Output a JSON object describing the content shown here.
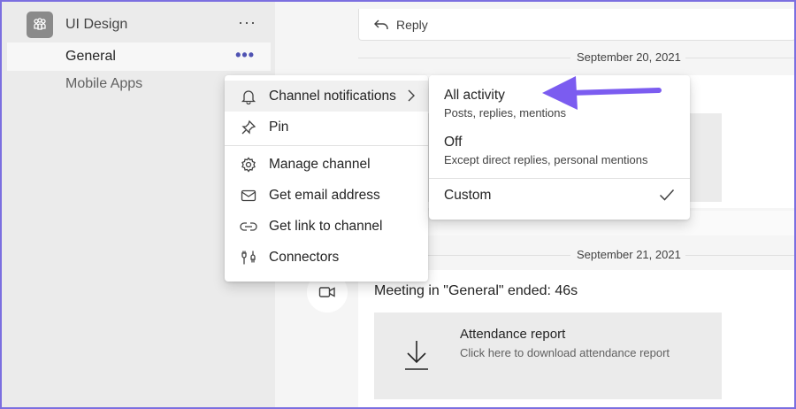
{
  "sidebar": {
    "team": {
      "name": "UI Design",
      "more_label": "···"
    },
    "channels": [
      {
        "label": "General",
        "more_label": "•••"
      },
      {
        "label": "Mobile Apps"
      }
    ]
  },
  "feed": {
    "reply_label": "Reply",
    "dates": [
      "September 20, 2021",
      "September 21, 2021"
    ],
    "meeting_text": "Meeting in \"General\" ended: 46s",
    "attendance": {
      "title": "Attendance report",
      "subtitle": "Click here to download attendance report"
    }
  },
  "context_menu": {
    "items": [
      {
        "label": "Channel notifications",
        "icon": "bell-icon"
      },
      {
        "label": "Pin",
        "icon": "pin-icon"
      },
      {
        "label": "Manage channel",
        "icon": "gear-icon"
      },
      {
        "label": "Get email address",
        "icon": "mail-icon"
      },
      {
        "label": "Get link to channel",
        "icon": "link-icon"
      },
      {
        "label": "Connectors",
        "icon": "connector-icon"
      }
    ]
  },
  "notifications_submenu": {
    "options": [
      {
        "title": "All activity",
        "description": "Posts, replies, mentions"
      },
      {
        "title": "Off",
        "description": "Except direct replies, personal mentions"
      },
      {
        "title": "Custom",
        "selected": true
      }
    ]
  },
  "colors": {
    "accent": "#4f52b2",
    "annotation_arrow": "#7b5cf0",
    "border": "#7b6fe0"
  }
}
